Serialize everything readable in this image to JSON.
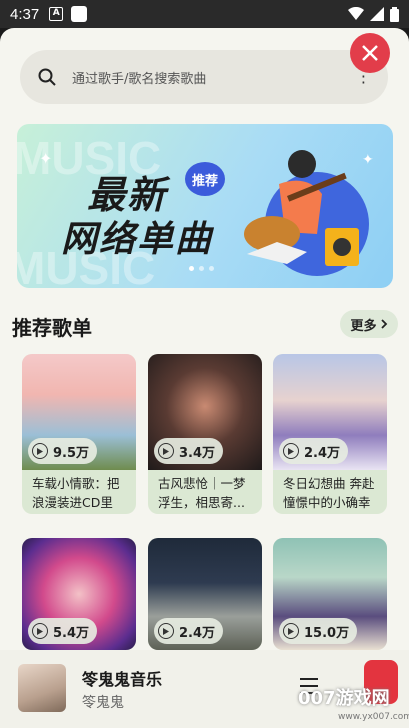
{
  "status_bar": {
    "time": "4:37",
    "app_icon_letter": "A"
  },
  "search": {
    "placeholder": "通过歌手/歌名搜索歌曲"
  },
  "banner": {
    "title_line1": "最新",
    "title_line2": "网络单曲",
    "badge": "推荐",
    "slide_count": 3,
    "active_slide": 1
  },
  "section": {
    "title": "推荐歌单",
    "more_label": "更多"
  },
  "playlists": [
    {
      "plays": "9.5万",
      "caption": "车载小情歌：把浪漫装进CD里"
    },
    {
      "plays": "3.4万",
      "caption": "古风悲怆｜一梦浮生，相思寄..."
    },
    {
      "plays": "2.4万",
      "caption": "冬日幻想曲 奔赴憧憬中的小确幸"
    },
    {
      "plays": "5.4万",
      "caption": ""
    },
    {
      "plays": "2.4万",
      "caption": ""
    },
    {
      "plays": "15.0万",
      "caption": ""
    }
  ],
  "player": {
    "song": "笭鬼鬼音乐",
    "artist": "笭鬼鬼"
  },
  "watermark": {
    "text": "007游戏网",
    "url": "www.yx007.com"
  },
  "colors": {
    "accent_red": "#e23d4a",
    "card_bg": "#dbe8d3",
    "app_bg": "#f5f5ef"
  }
}
